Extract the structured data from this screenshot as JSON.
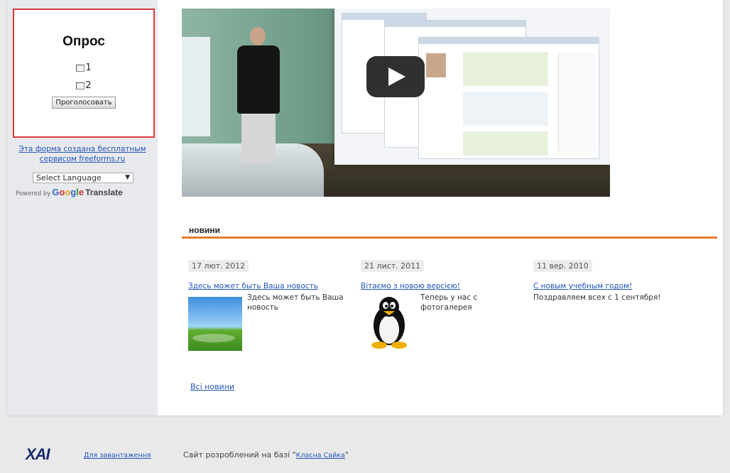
{
  "poll": {
    "title": "Опрос",
    "options": [
      "1",
      "2"
    ],
    "vote_label": "Проголосовать"
  },
  "sidebar": {
    "freeforms_text": "Эта форма создана бесплатным сервисом freeforms.ru",
    "language_select": "Select Language",
    "powered_by": "Powered by",
    "google": "Google",
    "translate": "Translate"
  },
  "video": {
    "play_icon": "play-icon"
  },
  "news": {
    "heading": "новини",
    "items": [
      {
        "date": "17 лют. 2012",
        "title": "Здесь может быть Ваша новость",
        "text": "Здесь может быть Ваша новость",
        "image": "windows-wallpaper-thumbnail"
      },
      {
        "date": "21 лист. 2011",
        "title": "Вітаємо з новою версією!",
        "text": "Теперь у нас с фотогалерея",
        "image": "tux-penguin-thumbnail"
      },
      {
        "date": "11 вер. 2010",
        "title": "С новым учебным годом!",
        "text": "Поздравляем всех с 1 сентября!",
        "image": ""
      }
    ],
    "all_news": "Всі новини"
  },
  "footer": {
    "logo_text": "ХАІ",
    "link_text": "Для завантаження",
    "site_text_prefix": "Сайт розроблений на базі \"",
    "site_link": "Класна Сайка",
    "site_text_suffix": "\""
  },
  "colors": {
    "accent_orange": "#e87b2b",
    "poll_border": "#d93a3a",
    "link_blue": "#2255bb"
  }
}
